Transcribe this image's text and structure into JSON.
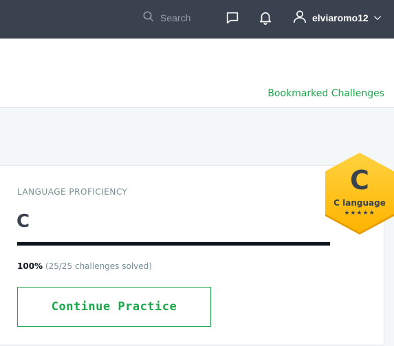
{
  "header": {
    "search": {
      "placeholder": "Search"
    },
    "user": {
      "name": "elviaromo12"
    }
  },
  "subheader": {
    "bookmark_link": "Bookmarked Challenges"
  },
  "proficiency": {
    "label": "LANGUAGE PROFICIENCY",
    "language": "C",
    "progress_fraction": 1.0,
    "percent_text": "100%",
    "solved_text": " (25/25 challenges solved)",
    "button_label": "Continue Practice"
  },
  "badge": {
    "letter": "C",
    "label": "C language",
    "stars": "★★★★★",
    "star_count": 5
  },
  "colors": {
    "topbar": "#39424e",
    "accent_green": "#1ba94c",
    "badge_gold": "#ffc107"
  },
  "icons": {
    "search": "search-icon",
    "messages": "message-icon",
    "notifications": "bell-icon",
    "user": "user-icon",
    "dropdown": "chevron-down-icon"
  }
}
